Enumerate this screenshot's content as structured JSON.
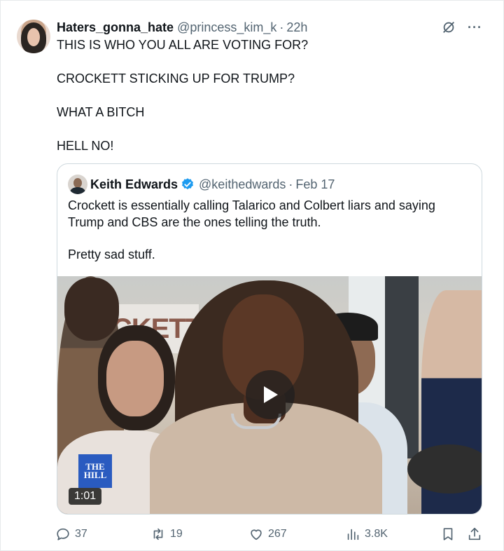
{
  "post": {
    "author_name": "Haters_gonna_hate",
    "author_handle": "@princess_kim_k",
    "separator": "·",
    "timestamp": "22h",
    "more_glyph": "···",
    "text_lines": [
      "THIS IS WHO YOU ALL ARE VOTING FOR?",
      "CROCKETT STICKING UP FOR TRUMP?",
      "WHAT A BITCH",
      "HELL NO!"
    ]
  },
  "quote": {
    "author_name": "Keith Edwards",
    "author_handle": "@keithedwards",
    "separator": "·",
    "timestamp": "Feb 17",
    "text_lines": [
      "Crockett is essentially calling Talarico and Colbert liars and saying Trump and CBS are the ones telling the truth.",
      "Pretty sad stuff."
    ],
    "media": {
      "banner_text": "CKETT",
      "logo_line1": "THE",
      "logo_line2": "HILL",
      "duration": "1:01"
    }
  },
  "actions": {
    "replies": "37",
    "reposts": "19",
    "likes": "267",
    "views": "3.8K"
  },
  "colors": {
    "text_primary": "#0f1419",
    "text_secondary": "#536471",
    "verified_blue": "#1d9bf0",
    "border": "#cfd9de"
  },
  "icons": [
    "grok-icon",
    "more-icon",
    "verified-icon",
    "play-icon",
    "reply-icon",
    "repost-icon",
    "like-icon",
    "views-icon",
    "bookmark-icon",
    "share-icon"
  ]
}
